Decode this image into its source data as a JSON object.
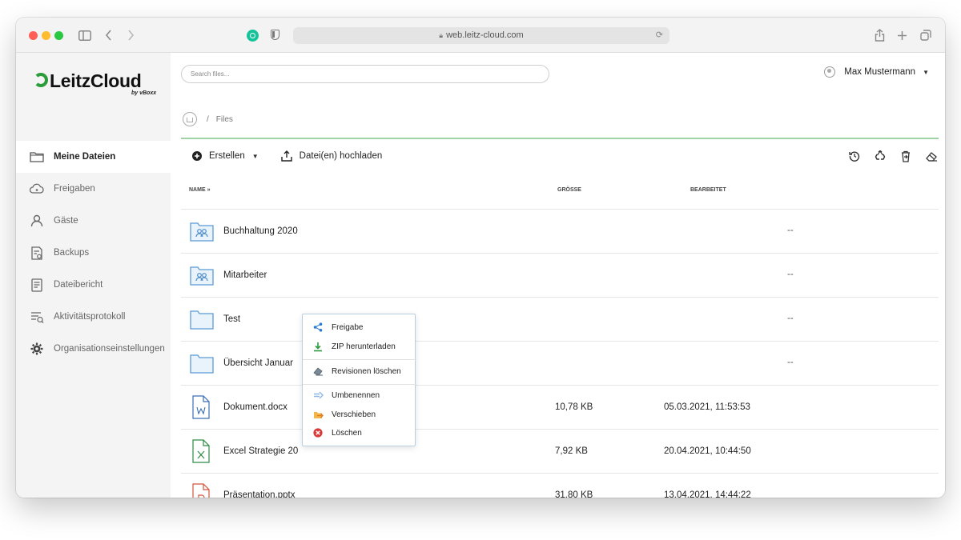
{
  "browser": {
    "url": "web.leitz-cloud.com"
  },
  "logo": {
    "name": "LeitzCloud",
    "sub": "by vBoxx"
  },
  "sidebar": {
    "items": [
      {
        "label": "Meine Dateien",
        "icon": "folder-icon",
        "active": true
      },
      {
        "label": "Freigaben",
        "icon": "share-cloud-icon"
      },
      {
        "label": "Gäste",
        "icon": "user-icon"
      },
      {
        "label": "Backups",
        "icon": "backup-icon"
      },
      {
        "label": "Dateibericht",
        "icon": "report-icon"
      },
      {
        "label": "Aktivitätsprotokoll",
        "icon": "activity-log-icon"
      },
      {
        "label": "Organisationseinstellungen",
        "icon": "gear-icon"
      }
    ]
  },
  "search": {
    "placeholder": "Search files..."
  },
  "user": {
    "name": "Max Mustermann"
  },
  "breadcrumb": {
    "current": "Files"
  },
  "toolbar": {
    "create_label": "Erstellen",
    "upload_label": "Datei(en) hochladen"
  },
  "table": {
    "headers": {
      "name": "NAME",
      "size": "GRÖSSE",
      "edited": "BEARBEITET"
    },
    "rows": [
      {
        "name": "Buchhaltung 2020",
        "type": "shared-folder",
        "size": "",
        "date": "",
        "dash": "--"
      },
      {
        "name": "Mitarbeiter",
        "type": "shared-folder",
        "size": "",
        "date": "",
        "dash": "--"
      },
      {
        "name": "Test",
        "type": "folder",
        "size": "",
        "date": "",
        "dash": "--"
      },
      {
        "name": "Übersicht Januar",
        "type": "folder",
        "size": "",
        "date": "",
        "dash": "--"
      },
      {
        "name": "Dokument.docx",
        "type": "word",
        "size": "10,78 KB",
        "date": "05.03.2021, 11:53:53",
        "dash": ""
      },
      {
        "name": "Excel Strategie 20",
        "type": "excel",
        "size": "7,92 KB",
        "date": "20.04.2021, 10:44:50",
        "dash": ""
      },
      {
        "name": "Präsentation.pptx",
        "type": "powerpoint",
        "size": "31,80 KB",
        "date": "13.04.2021, 14:44:22",
        "dash": ""
      }
    ]
  },
  "context_menu": {
    "items": [
      {
        "label": "Freigabe",
        "icon": "share-icon"
      },
      {
        "label": "ZIP herunterladen",
        "icon": "download-icon"
      },
      {
        "label": "Revisionen löschen",
        "icon": "eraser-icon"
      },
      {
        "label": "Umbenennen",
        "icon": "rename-arrow-icon"
      },
      {
        "label": "Verschieben",
        "icon": "move-icon"
      },
      {
        "label": "Löschen",
        "icon": "delete-icon"
      }
    ]
  }
}
